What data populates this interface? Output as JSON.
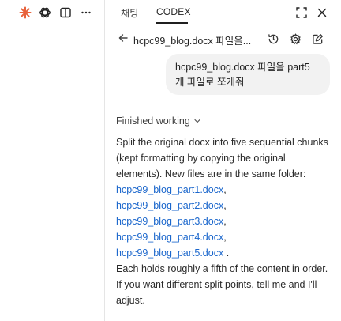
{
  "tabs": {
    "chat": "채팅",
    "codex": "CODEX"
  },
  "thread": {
    "title": "hcpc99_blog.docx 파일을..."
  },
  "user_message": "hcpc99_blog.docx 파일을 part5 개 파일로 쪼개줘",
  "status": {
    "label": "Finished working"
  },
  "assistant": {
    "intro": "Split the original docx into five sequential chunks (kept formatting by copying the original elements). New files are in the same folder:",
    "files": [
      "hcpc99_blog_part1.docx",
      "hcpc99_blog_part2.docx",
      "hcpc99_blog_part3.docx",
      "hcpc99_blog_part4.docx",
      "hcpc99_blog_part5.docx"
    ],
    "sep": ", ",
    "end": ".",
    "line2": "Each holds roughly a fifth of the content in order.",
    "line3": "If you want different split points, tell me and I'll adjust."
  },
  "colors": {
    "link": "#1a66cc",
    "openai_orange": "#e8623c",
    "bubble": "#f2f2f2"
  },
  "icons": {
    "left_toolbar": [
      "sparkle-icon",
      "openai-logo-icon",
      "panel-toggle-icon",
      "more-icon"
    ],
    "tab_bar": [
      "expand-icon",
      "close-icon"
    ],
    "thread_header": [
      "back-arrow-icon",
      "history-icon",
      "settings-icon",
      "new-chat-icon"
    ]
  }
}
